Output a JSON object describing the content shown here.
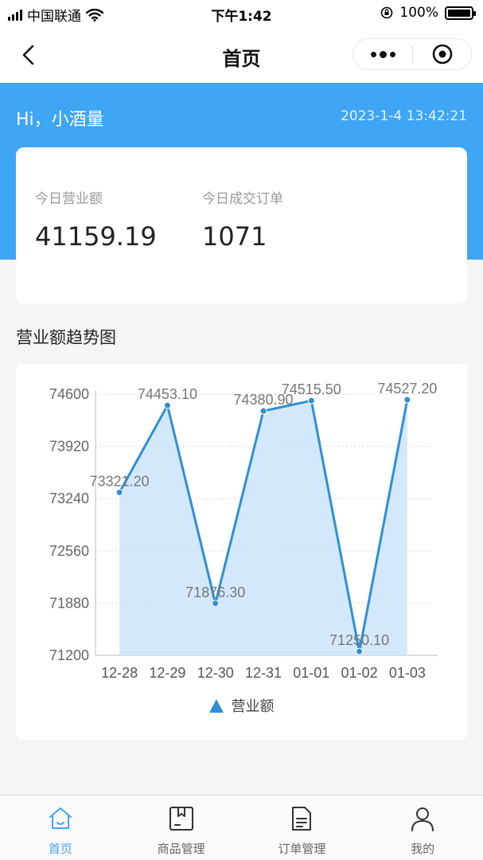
{
  "status_bar": {
    "carrier": "中国联通",
    "time": "下午1:42",
    "battery": "100%"
  },
  "nav": {
    "title": "首页",
    "icons": {
      "back": "chevron-left-icon",
      "more": "more-dots-icon",
      "close": "target-circle-icon"
    }
  },
  "header": {
    "greeting": "Hi，小酒量",
    "datetime": "2023-1-4 13:42:21"
  },
  "stats": {
    "revenue_label": "今日营业额",
    "revenue_value": "41159.19",
    "orders_label": "今日成交订单",
    "orders_value": "1071"
  },
  "section": {
    "chart_title": "营业额趋势图"
  },
  "colors": {
    "primary": "#3fa5f5",
    "line": "#2e8fd6",
    "area": "#cfe6fb"
  },
  "chart_data": {
    "type": "area",
    "categories": [
      "12-28",
      "12-29",
      "12-30",
      "12-31",
      "01-01",
      "01-02",
      "01-03"
    ],
    "series": [
      {
        "name": "营业额",
        "values": [
          73321.2,
          74453.1,
          71876.3,
          74380.9,
          74515.5,
          71250.1,
          74527.2
        ],
        "labels": [
          "73321.20",
          "74453.10",
          "71876.30",
          "74380.90",
          "74515.50",
          "71250.10",
          "74527.20"
        ]
      }
    ],
    "yticks": [
      "74600",
      "73920",
      "73240",
      "72560",
      "71880",
      "71200"
    ],
    "ylim": [
      71200,
      74600
    ],
    "grid": true,
    "legend_position": "bottom"
  },
  "tabs": [
    {
      "label": "首页",
      "icon": "home-icon",
      "active": true
    },
    {
      "label": "商品管理",
      "icon": "box-icon",
      "active": false
    },
    {
      "label": "订单管理",
      "icon": "document-icon",
      "active": false
    },
    {
      "label": "我的",
      "icon": "user-icon",
      "active": false
    }
  ]
}
